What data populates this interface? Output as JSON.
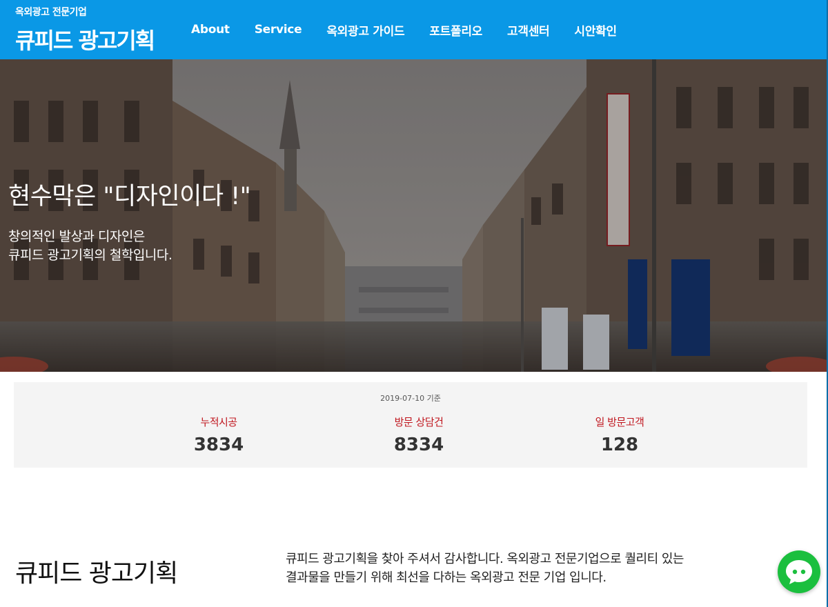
{
  "header": {
    "logo_tagline": "옥외광고 전문기업",
    "logo_title": "큐피드 광고기획",
    "nav": [
      "About",
      "Service",
      "옥외광고 가이드",
      "포트폴리오",
      "고객센터",
      "시안확인"
    ]
  },
  "hero": {
    "title": "현수막은 \"디자인이다 !\"",
    "subtitle_line1": "창의적인 발상과 디자인은",
    "subtitle_line2": "큐피드 광고기획의 철학입니다."
  },
  "stats": {
    "date_note": "2019-07-10 기준",
    "items": [
      {
        "label": "누적시공",
        "value": "3834"
      },
      {
        "label": "방문 상담건",
        "value": "8334"
      },
      {
        "label": "일 방문고객",
        "value": "128"
      }
    ]
  },
  "about": {
    "title": "큐피드 광고기획",
    "line1": "큐피드 광고기획을 찾아 주셔서 감사합니다. 옥외광고 전문기업으로 퀄리티 있는",
    "line2": "결과물을 만들기 위해 최선을 다하는 옥외광고 전문 기업 입니다."
  },
  "chat": {
    "icon": "chat-bubble-icon"
  },
  "colors": {
    "header_bg": "#0a98e6",
    "stat_label": "#c0161e",
    "chat_bg": "#1bbf3e"
  }
}
